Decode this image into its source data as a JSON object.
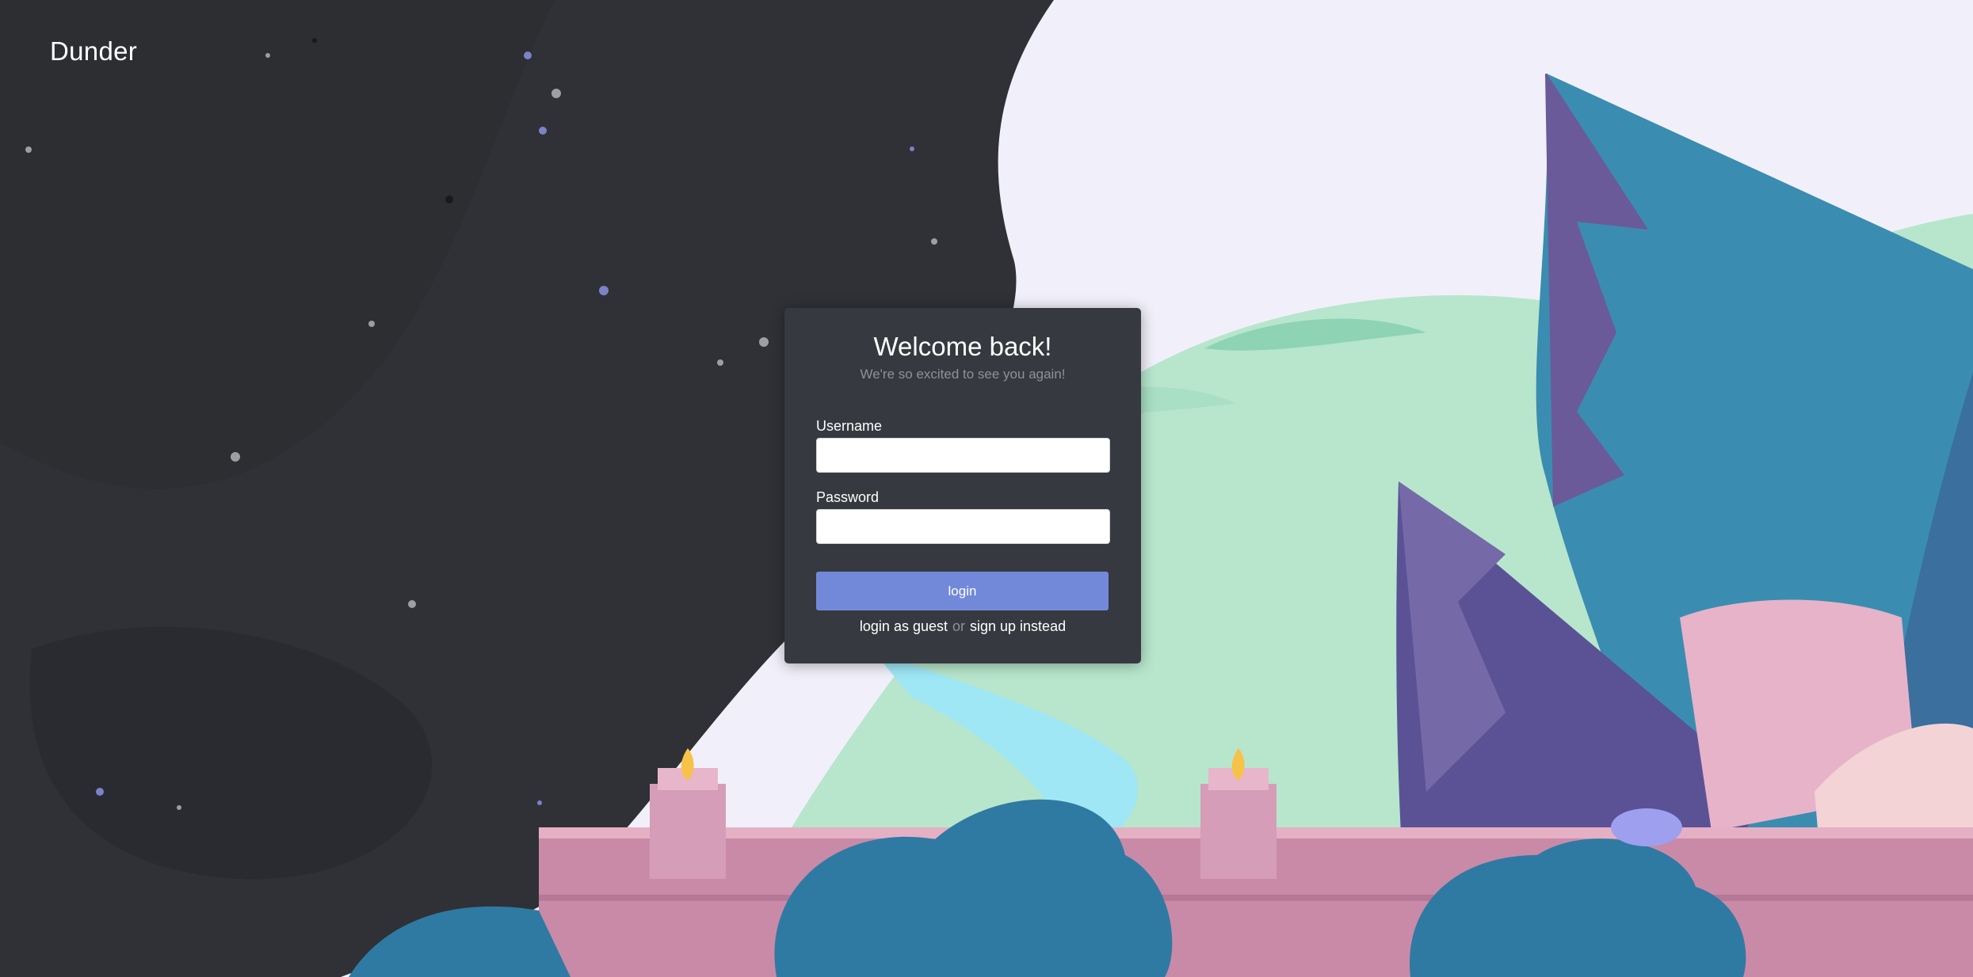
{
  "brand": {
    "name": "Dunder"
  },
  "card": {
    "title": "Welcome back!",
    "subtitle": "We're so excited to see you again!",
    "username_label": "Username",
    "username_value": "",
    "password_label": "Password",
    "password_value": "",
    "login_label": "login",
    "guest_link": "login as guest",
    "or_text": "or",
    "signup_link": "sign up instead"
  },
  "colors": {
    "page_bg": "#2f3136",
    "card_bg": "#36393f",
    "accent": "#7289da",
    "muted_text": "#8e9297"
  },
  "icons": {
    "background": "landscape-illustration"
  }
}
